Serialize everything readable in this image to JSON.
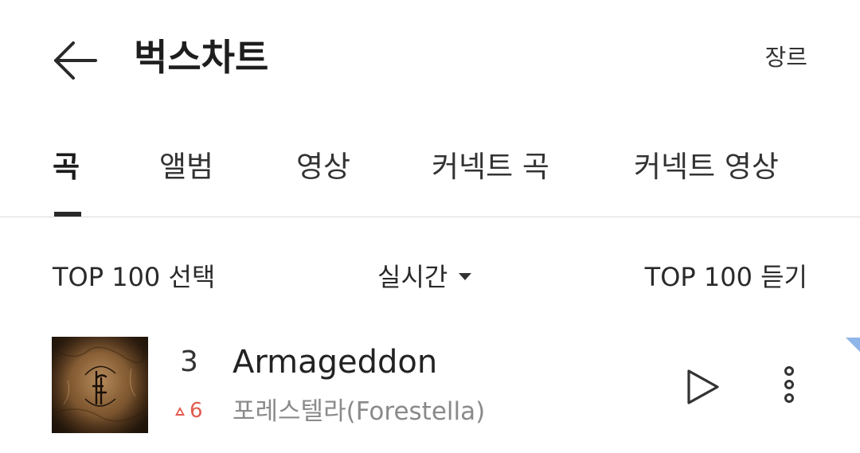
{
  "header": {
    "title": "벅스차트",
    "genre_label": "장르"
  },
  "tabs": [
    {
      "label": "곡",
      "active": true
    },
    {
      "label": "앨범",
      "active": false
    },
    {
      "label": "영상",
      "active": false
    },
    {
      "label": "커넥트 곡",
      "active": false
    },
    {
      "label": "커넥트 영상",
      "active": false
    }
  ],
  "toolbar": {
    "select_label": "TOP 100 선택",
    "period_label": "실시간",
    "listen_label": "TOP 100 듣기"
  },
  "songs": [
    {
      "rank": "3",
      "change": "6",
      "change_direction": "up",
      "title": "Armageddon",
      "artist": "포레스텔라(Forestella)"
    }
  ],
  "colors": {
    "accent_up": "#e05a4e",
    "tab_indicator": "#2a2a2a",
    "corner_mark": "#8fb6e8"
  }
}
